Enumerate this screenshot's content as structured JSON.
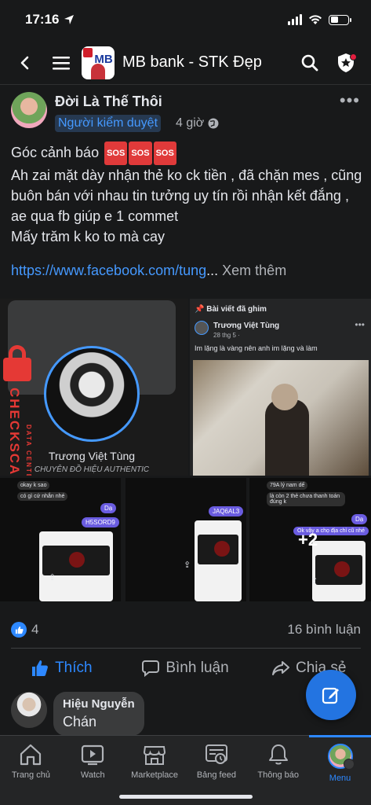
{
  "status": {
    "time": "17:16"
  },
  "header": {
    "group_name": "MB bank - STK Đẹp",
    "group_avatar_text": "MB"
  },
  "post": {
    "author": "Đời Là Thế Thôi",
    "badge": "Người kiểm duyệt",
    "time": "4 giờ",
    "body_line1": "Góc cảnh báo",
    "sos_label": "SOS",
    "body_rest": "Ah zai mặt dày nhận thẻ ko ck tiền , đã chặn mes , cũng buôn bán với nhau tin tưởng uy tín rồi nhận kết đắng , ae qua fb giúp e 1 commet\nMấy trăm k ko to mà cay",
    "link": "https://www.facebook.com/tung",
    "link_ellipsis": "...",
    "see_more": " Xem thêm"
  },
  "media": {
    "profile_name": "Trương Việt Tùng",
    "profile_sub": "CHUYÊN ĐỒ HIỆU AUTHENTIC",
    "watermark_main": "CHECKSCAM.INFO",
    "watermark_small": "DATA CENTER",
    "pinned_header": "Bài viết đã ghim",
    "pinned_name": "Trương Việt Tùng",
    "pinned_date": "28 thg 5 ·",
    "pinned_caption": "Im lặng là vàng nên anh im lặng và làm",
    "chat1_bubble1": "okay k sao",
    "chat1_bubble2": "có gì cứ nhắn nhé",
    "chat1_reply1": "Dạ",
    "chat1_reply2": "H5SORD9",
    "chat2_reply": "JAQ6AL3",
    "chat3_bubble1": "79A lý nam dế",
    "chat3_bubble2": "là còn 2 thẻ chưa thanh toán đúng k",
    "chat3_reply1": "Dạ",
    "chat3_reply2": "Ok vậy a chọ địa chỉ cũ nhé",
    "more_count": "+2"
  },
  "stats": {
    "likes": "4",
    "comments": "16 bình luận"
  },
  "actions": {
    "like": "Thích",
    "comment": "Bình luận",
    "share": "Chia sẻ"
  },
  "comment": {
    "author": "Hiệu Nguyễn",
    "text": "Chán"
  },
  "nav": {
    "home": "Trang chủ",
    "watch": "Watch",
    "marketplace": "Marketplace",
    "feed": "Bảng feed",
    "notifications": "Thông báo",
    "menu": "Menu"
  },
  "colors": {
    "accent": "#2d88ff",
    "background": "#18191a",
    "badge_bg": "#263951",
    "warning_red": "#e53935"
  }
}
